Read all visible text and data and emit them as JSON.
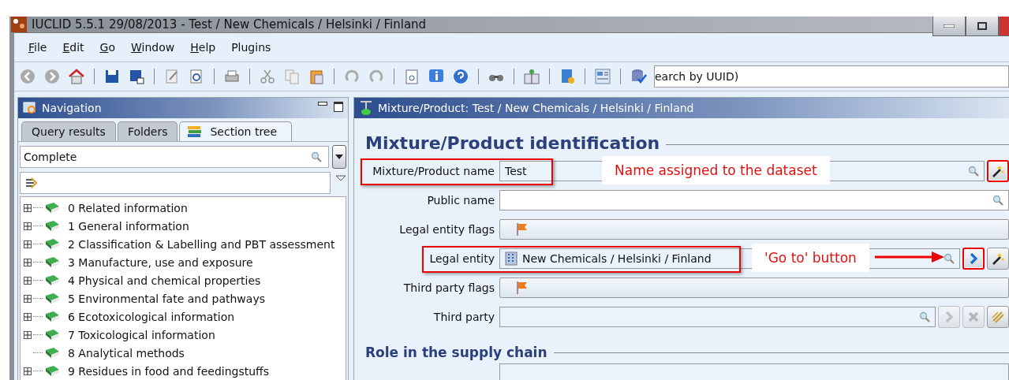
{
  "window": {
    "title": "IUCLID 5.5.1 29/08/2013 - Test / New Chemicals / Helsinki / Finland"
  },
  "menu": [
    {
      "label": "File",
      "mnemonic": true
    },
    {
      "label": "Edit",
      "mnemonic": true
    },
    {
      "label": "Go",
      "mnemonic": true
    },
    {
      "label": "Window",
      "mnemonic": true
    },
    {
      "label": "Help",
      "mnemonic": true
    },
    {
      "label": "Plugins",
      "mnemonic": false
    }
  ],
  "toolbar": {
    "search_value": "earch by UUID)"
  },
  "navigation": {
    "title": "Navigation",
    "tabs": [
      {
        "label": "Query results",
        "selected": false
      },
      {
        "label": "Folders",
        "selected": false
      },
      {
        "label": "Section tree",
        "selected": true
      }
    ],
    "view_combo": "Complete",
    "tree": [
      {
        "label": "0 Related information",
        "expandable": true
      },
      {
        "label": "1 General information",
        "expandable": true
      },
      {
        "label": "2 Classification & Labelling and PBT assessment",
        "expandable": true
      },
      {
        "label": "3 Manufacture, use and exposure",
        "expandable": true
      },
      {
        "label": "4 Physical and chemical properties",
        "expandable": true
      },
      {
        "label": "5 Environmental fate and pathways",
        "expandable": true
      },
      {
        "label": "6 Ecotoxicological information",
        "expandable": true
      },
      {
        "label": "7 Toxicological information",
        "expandable": true
      },
      {
        "label": "8 Analytical methods",
        "expandable": false
      },
      {
        "label": "9 Residues in food and feedingstuffs",
        "expandable": true
      }
    ]
  },
  "editor": {
    "title": "Mixture/Product: Test / New Chemicals / Helsinki / Finland",
    "section": "Mixture/Product identification",
    "fields": [
      {
        "label": "Mixture/Product name",
        "kind": "text",
        "value": "Test",
        "highlighted": true,
        "callout": "Name assigned to the dataset",
        "buttons": [
          {
            "kind": "wand",
            "highlighted": true,
            "disabled": false
          }
        ]
      },
      {
        "label": "Public name",
        "kind": "text",
        "highlighted": false
      },
      {
        "label": "Legal entity flags",
        "kind": "flags",
        "highlighted": false
      },
      {
        "label": "Legal entity",
        "kind": "reference",
        "value": "New Chemicals / Helsinki / Finland",
        "highlighted": true,
        "callout": "'Go to' button",
        "buttons": [
          {
            "kind": "goto",
            "highlighted": true,
            "disabled": false
          },
          {
            "kind": "wand",
            "highlighted": false,
            "disabled": false
          }
        ]
      },
      {
        "label": "Third party flags",
        "kind": "flags",
        "highlighted": false
      },
      {
        "label": "Third party",
        "kind": "reference",
        "highlighted": false,
        "buttons": [
          {
            "kind": "goto",
            "highlighted": false,
            "disabled": true
          },
          {
            "kind": "delete",
            "highlighted": false,
            "disabled": true
          },
          {
            "kind": "link",
            "highlighted": false,
            "disabled": false
          }
        ]
      }
    ],
    "section2": "Role in the supply chain"
  }
}
